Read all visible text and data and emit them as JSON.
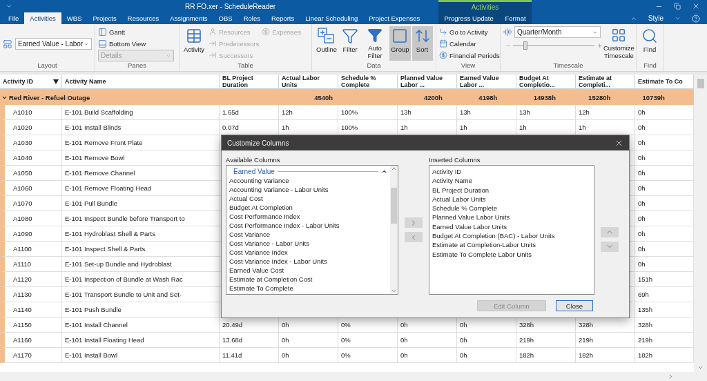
{
  "window": {
    "title": "RR FO.xer - ScheduleReader",
    "context_label": "Activities"
  },
  "tabs": [
    {
      "label": "File",
      "selected": false,
      "contextual": false
    },
    {
      "label": "Activities",
      "selected": true,
      "contextual": false
    },
    {
      "label": "WBS",
      "selected": false,
      "contextual": false
    },
    {
      "label": "Projects",
      "selected": false,
      "contextual": false
    },
    {
      "label": "Resources",
      "selected": false,
      "contextual": false
    },
    {
      "label": "Assignments",
      "selected": false,
      "contextual": false
    },
    {
      "label": "OBS",
      "selected": false,
      "contextual": false
    },
    {
      "label": "Roles",
      "selected": false,
      "contextual": false
    },
    {
      "label": "Reports",
      "selected": false,
      "contextual": false
    },
    {
      "label": "Linear Scheduling",
      "selected": false,
      "contextual": false
    },
    {
      "label": "Project Expenses",
      "selected": false,
      "contextual": false
    },
    {
      "label": "Progress Update",
      "selected": false,
      "contextual": true
    },
    {
      "label": "Format",
      "selected": false,
      "contextual": true
    }
  ],
  "style_menu": {
    "label": "Style"
  },
  "ribbon": {
    "layout": {
      "caption": "Layout",
      "value": "Earned Value - Labor"
    },
    "panes": {
      "caption": "Panes",
      "items": [
        "Gantt",
        "Bottom View"
      ],
      "details": {
        "value": "Details",
        "disabled": true
      }
    },
    "table": {
      "caption": "Table",
      "main": "Activity",
      "items": [
        {
          "label": "Resources",
          "disabled": true
        },
        {
          "label": "Predecessors",
          "disabled": true
        },
        {
          "label": "Successors",
          "disabled": true
        },
        {
          "label": "Expenses",
          "disabled": true
        }
      ]
    },
    "data": {
      "caption": "Data",
      "buttons": [
        {
          "label": "Outline",
          "selected": false
        },
        {
          "label": "Filter",
          "selected": false
        },
        {
          "label": "Auto Filter",
          "selected": false
        },
        {
          "label": "Group",
          "selected": true
        },
        {
          "label": "Sort",
          "selected": true
        }
      ]
    },
    "view": {
      "caption": "View",
      "items": [
        "Go to Activity",
        "Calendar",
        "Financial Periods"
      ]
    },
    "timescale": {
      "caption": "Timescale",
      "value": "Quarter/Month",
      "minus": "−",
      "plus": "+",
      "slider": {
        "level": 0.15
      },
      "customize": "Customize Timescale"
    },
    "find": {
      "caption": "Find",
      "button": "Find"
    }
  },
  "grid": {
    "columns": [
      "Activity ID",
      "Activity Name",
      "BL Project Duration",
      "Actual Labor Units",
      "Schedule % Complete",
      "Planned Value Labor ...",
      "Earned Value Labor ...",
      "Budget At Completio...",
      "Estimate at Completi...",
      "Estimate To Co"
    ],
    "group_row": {
      "label": "Red River - Refuel Outage",
      "expanded": true,
      "cells": [
        null,
        null,
        "4540h",
        null,
        "4200h",
        "4198h",
        "14938h",
        "15280h",
        "10739h"
      ]
    },
    "rows": [
      {
        "cells": [
          "A1010",
          "E-101 Build Scaffolding",
          "1.65d",
          "12h",
          "100%",
          "13h",
          "13h",
          "13h",
          "12h",
          "0h"
        ]
      },
      {
        "cells": [
          "A1020",
          "E-101 Install Blinds",
          "0.07d",
          "1h",
          "100%",
          "1h",
          "1h",
          "1h",
          "1h",
          "0h"
        ]
      },
      {
        "cells": [
          "A1030",
          "E-101 Remove Front Plate",
          null,
          null,
          null,
          null,
          null,
          null,
          null,
          "0h"
        ]
      },
      {
        "cells": [
          "A1040",
          "E-101 Remove Bowl",
          null,
          null,
          null,
          null,
          null,
          null,
          null,
          "0h"
        ]
      },
      {
        "cells": [
          "A1050",
          "E-101 Remove Channel",
          null,
          null,
          null,
          null,
          null,
          null,
          null,
          "0h"
        ]
      },
      {
        "cells": [
          "A1060",
          "E-101 Remove Floating Head",
          null,
          null,
          null,
          null,
          null,
          null,
          null,
          "0h"
        ]
      },
      {
        "cells": [
          "A1070",
          "E-101 Pull Bundle",
          null,
          null,
          null,
          null,
          null,
          null,
          null,
          "0h"
        ]
      },
      {
        "cells": [
          "A1080",
          "E-101 Inspect Bundle before Transport to",
          null,
          null,
          null,
          null,
          null,
          null,
          null,
          "0h"
        ]
      },
      {
        "cells": [
          "A1090",
          "E-101 Hydroblast Shell & Parts",
          null,
          null,
          null,
          null,
          null,
          null,
          null,
          "0h"
        ]
      },
      {
        "cells": [
          "A1100",
          "E-101 Inspect Shell & Parts",
          null,
          null,
          null,
          null,
          null,
          null,
          null,
          "0h"
        ]
      },
      {
        "cells": [
          "A1110",
          "E-101 Set-up Bundle and Hydroblast",
          null,
          null,
          null,
          null,
          null,
          null,
          null,
          "0h"
        ]
      },
      {
        "cells": [
          "A1120",
          "E-101 Inspection of Bundle at Wash Rac",
          null,
          null,
          null,
          null,
          null,
          null,
          null,
          "151h"
        ]
      },
      {
        "cells": [
          "A1130",
          "E-101 Transport Bundle to Unit and Set-",
          null,
          null,
          null,
          null,
          null,
          null,
          null,
          "69h"
        ]
      },
      {
        "cells": [
          "A1140",
          "E-101 Push Bundle",
          null,
          null,
          null,
          null,
          null,
          null,
          null,
          "135h"
        ]
      },
      {
        "cells": [
          "A1150",
          "E-101 Install Channel",
          "20.49d",
          "0h",
          "0%",
          "0h",
          "0h",
          "328h",
          "328h",
          "328h"
        ]
      },
      {
        "cells": [
          "A1160",
          "E-101 Install Floating Head",
          "13.68d",
          "0h",
          "0%",
          "0h",
          "0h",
          "219h",
          "219h",
          "219h"
        ]
      },
      {
        "cells": [
          "A1170",
          "E-101 Install Bowl",
          "11.41d",
          "0h",
          "0%",
          "0h",
          "0h",
          "182h",
          "182h",
          "182h"
        ]
      }
    ]
  },
  "dialog": {
    "title": "Customize Columns",
    "available": {
      "label": "Available Columns",
      "group": "Earned Value",
      "items": [
        "Accounting Variance",
        "Accounting Variance - Labor Units",
        "Actual Cost",
        "Budget At Completion",
        "Cost Performance Index",
        "Cost Performance Index - Labor Units",
        "Cost Variance",
        "Cost Variance - Labor Units",
        "Cost Variance Index",
        "Cost Variance Index - Labor Units",
        "Earned Value Cost",
        "Estimate at Completion Cost",
        "Estimate To Complete"
      ]
    },
    "inserted": {
      "label": "Inserted Columns",
      "items": [
        "Activity ID",
        "Activity Name",
        "BL Project Duration",
        "Actual Labor Units",
        "Schedule % Complete",
        "Planned Value Labor Units",
        "Earned Value Labor Units",
        "Budget At Completion (BAC) - Labor Units",
        "Estimate at Completion-Labor Units",
        "Estimate To Complete Labor Units"
      ]
    },
    "buttons": [
      {
        "label": "Edit Column",
        "disabled": true,
        "focused": false
      },
      {
        "label": "Close",
        "disabled": false,
        "focused": true
      }
    ]
  }
}
